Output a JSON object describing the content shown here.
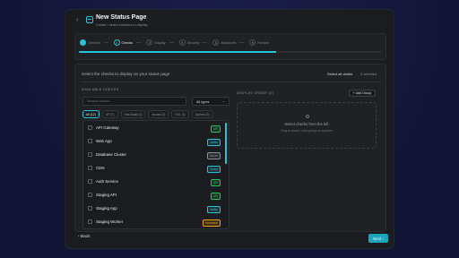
{
  "header": {
    "back_icon": "chevron-left-icon",
    "title_icon": "status-page-icon",
    "title": "New Status Page",
    "subtitle": "Create • select monitors to display"
  },
  "wizard": {
    "progress_fraction": 0.65,
    "steps": [
      {
        "number": "✓",
        "label": "General",
        "state": "done"
      },
      {
        "number": "2",
        "label": "Checks",
        "state": "active"
      },
      {
        "number": "3",
        "label": "Display",
        "state": "upcoming"
      },
      {
        "number": "4",
        "label": "Security",
        "state": "upcoming"
      },
      {
        "number": "5",
        "label": "Advanced",
        "state": "upcoming"
      },
      {
        "number": "6",
        "label": "Review",
        "state": "upcoming"
      }
    ]
  },
  "main": {
    "prompt": "Select the checks to display on your status page",
    "select_all_label": "Select all visible",
    "selected_count": "0 selected",
    "available_label": "AVAILABLE CHECKS",
    "search_placeholder": "Search checks...",
    "type_select_value": "All types",
    "filters": [
      {
        "label": "All (12)",
        "active": true
      },
      {
        "label": "UP (7)",
        "active": false
      },
      {
        "label": "Has Badd (1)",
        "active": false
      },
      {
        "label": "Issues (3)",
        "active": false
      },
      {
        "label": "SSL (1)",
        "active": false
      },
      {
        "label": "Uptime (9)",
        "active": false
      }
    ],
    "checks": [
      {
        "name": "API Gateway",
        "badge": "API",
        "badge_color": "#22c55e"
      },
      {
        "name": "Web App",
        "badge": "Active",
        "badge_color": "#22c5dd"
      },
      {
        "name": "Database Cluster",
        "badge": "Server",
        "badge_color": "#8a909b"
      },
      {
        "name": "CDN",
        "badge": "Active",
        "badge_color": "#22c5dd"
      },
      {
        "name": "Auth Service",
        "badge": "API",
        "badge_color": "#22c55e"
      },
      {
        "name": "Staging API",
        "badge": "API",
        "badge_color": "#22c55e"
      },
      {
        "name": "Staging App",
        "badge": "Active",
        "badge_color": "#22c5dd"
      },
      {
        "name": "Staging Worker",
        "badge": "Heartbeat",
        "badge_color": "#f59e0b"
      }
    ]
  },
  "display_order": {
    "label": "DISPLAY ORDER (0)",
    "add_group_label": "+ Add Group",
    "empty_text": "Select checks from the left",
    "empty_hint": "Drag to reorder • Add groups to organize"
  },
  "footer": {
    "back_label": "‹ Back",
    "next_label": "Next ›"
  },
  "colors": {
    "accent": "#22c5dd",
    "background": "#14163a",
    "surface": "#1a1c20"
  }
}
